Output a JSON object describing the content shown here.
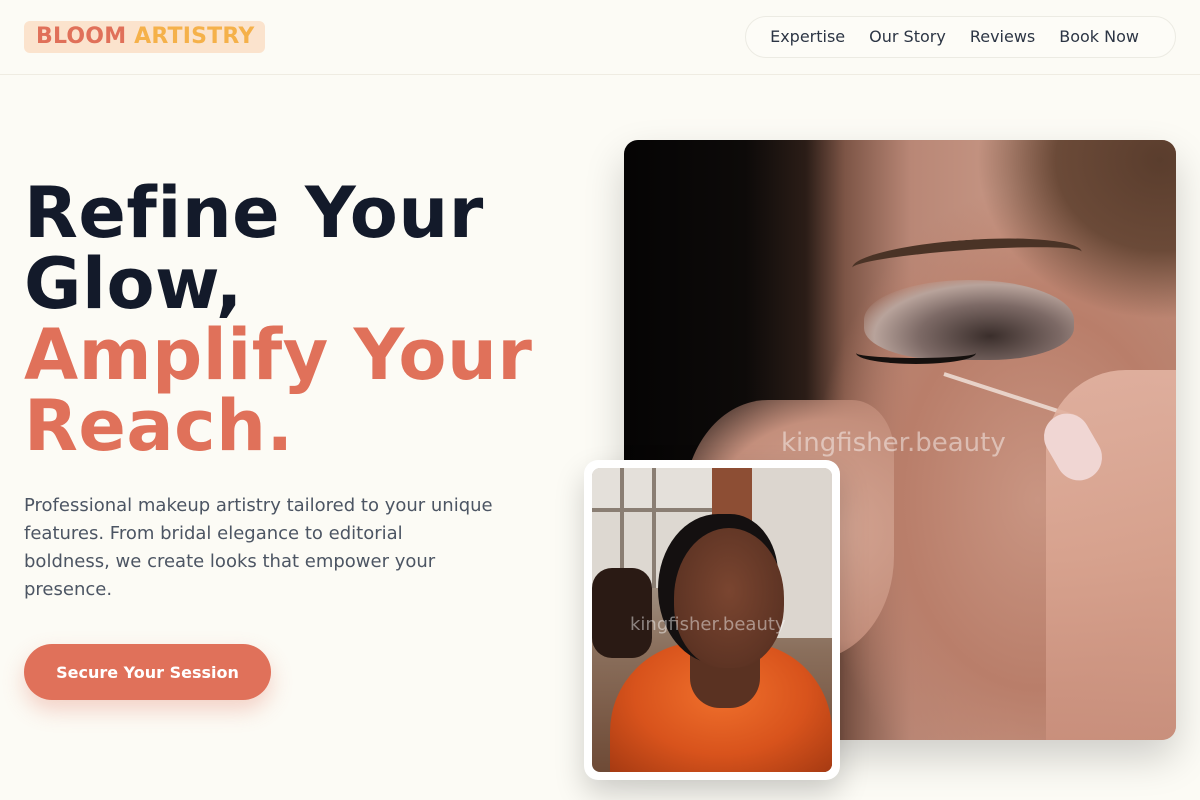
{
  "brand": {
    "word1": "BLOOM",
    "word2": "ARTISTRY"
  },
  "nav": {
    "items": [
      "Expertise",
      "Our Story",
      "Reviews",
      "Book Now"
    ]
  },
  "hero": {
    "headline_line1": "Refine Your",
    "headline_line2": "Glow,",
    "headline_accent_line1": "Amplify Your",
    "headline_accent_line2": "Reach.",
    "lead": "Professional makeup artistry tailored to your unique features. From bridal elegance to editorial boldness, we create looks that empower your presence.",
    "cta_label": "Secure Your Session"
  },
  "photos": {
    "main_watermark": "kingfisher.beauty",
    "inset_watermark": "kingfisher.beauty"
  },
  "colors": {
    "background": "#fcfbf5",
    "accent": "#e0715a",
    "accent_gold": "#f5b14a",
    "headline_dark": "#131a2a",
    "body_text": "#4c5563"
  }
}
